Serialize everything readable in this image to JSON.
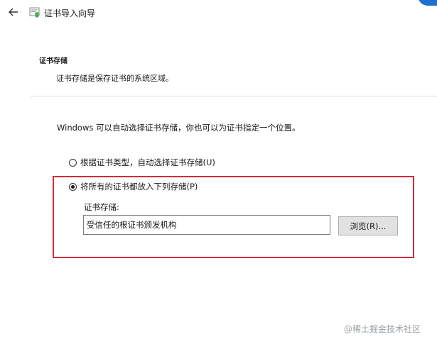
{
  "window": {
    "title": "证书导入向导"
  },
  "header": {
    "section_title": "证书存储",
    "section_desc": "证书存储是保存证书的系统区域。"
  },
  "main": {
    "intro": "Windows 可以自动选择证书存储，你也可以为证书指定一个位置。",
    "options": [
      {
        "label": "根据证书类型，自动选择证书存储(U)",
        "selected": false
      },
      {
        "label": "将所有的证书都放入下列存储(P)",
        "selected": true
      }
    ],
    "store_label": "证书存储:",
    "store_value": "受信任的根证书颁发机构",
    "browse_label": "浏览(R)..."
  },
  "watermark": "@稀土掘金技术社区",
  "colors": {
    "highlight": "#d42b3a",
    "corner_badge": "#1e6fd0"
  },
  "icons": [
    "back-arrow-icon",
    "certificate-icon"
  ]
}
